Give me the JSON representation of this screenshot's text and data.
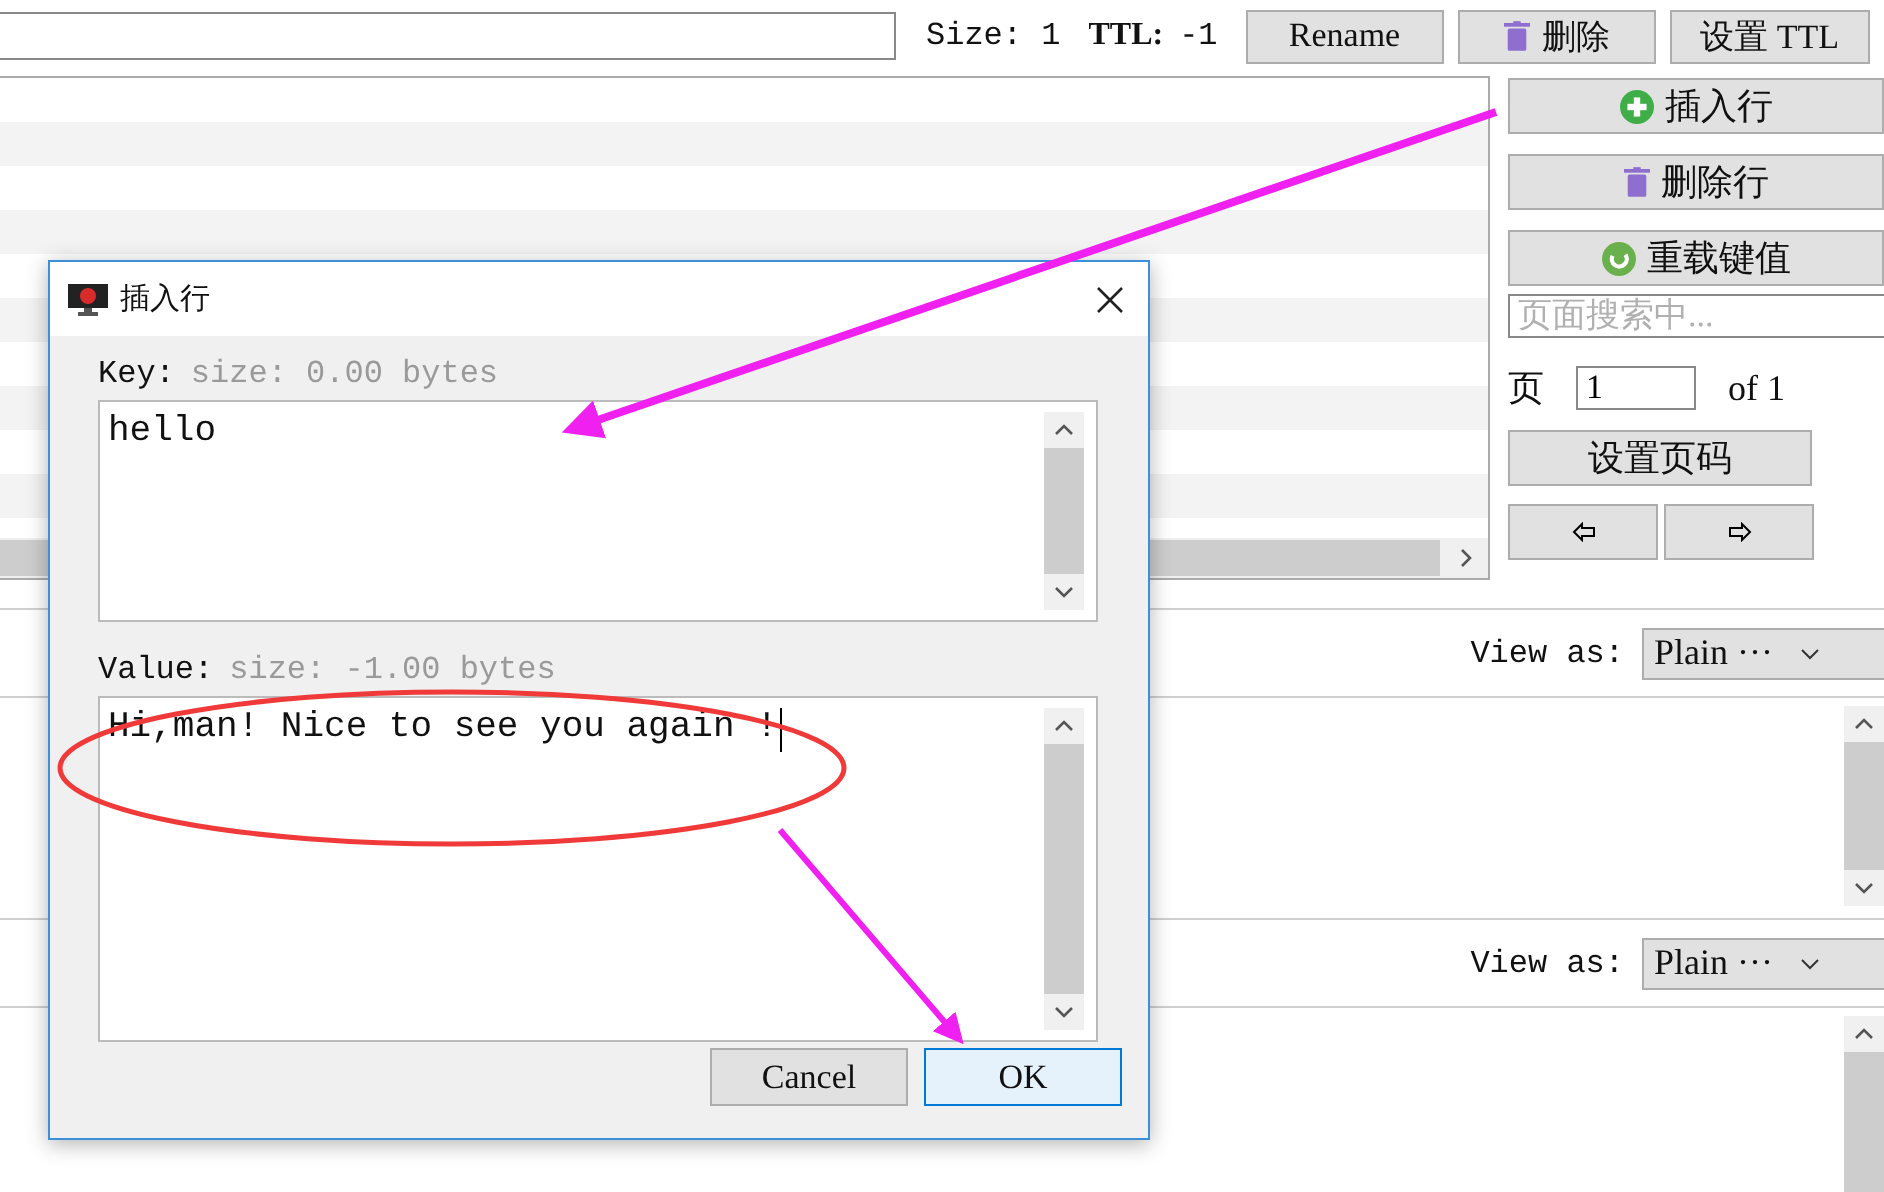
{
  "toolbar": {
    "size": "Size: 1",
    "ttl_label": "TTL:",
    "ttl_value": "-1",
    "buttons": [
      {
        "label": "Rename",
        "kind": "plain"
      },
      {
        "label": "删除",
        "kind": "trash"
      },
      {
        "label": "设置 TTL",
        "kind": "plain"
      }
    ]
  },
  "side_panel": {
    "buttons": [
      {
        "label": "插入行",
        "kind": "plus"
      },
      {
        "label": "删除行",
        "kind": "trash"
      },
      {
        "label": "重载键值",
        "kind": "reload"
      }
    ],
    "search": {
      "placeholder": "页面搜索中..."
    },
    "page_label": "页",
    "page_value": "1",
    "page_total": "of 1",
    "set_page_button": "设置页码"
  },
  "value_sections": [
    {
      "view_label": "View as:",
      "format": "Plain ···"
    },
    {
      "view_label": "View as:",
      "format": "Plain ···"
    }
  ],
  "dialog": {
    "title": "插入行",
    "key_label": "Key:",
    "key_size": "size: 0.00 bytes",
    "key_value": "hello",
    "value_label": "Value:",
    "value_size": "size: -1.00 bytes",
    "value_value": "Hi,man! Nice to see you again !",
    "buttons": [
      {
        "label": "Cancel",
        "selected": false
      },
      {
        "label": "OK",
        "selected": true
      }
    ]
  }
}
